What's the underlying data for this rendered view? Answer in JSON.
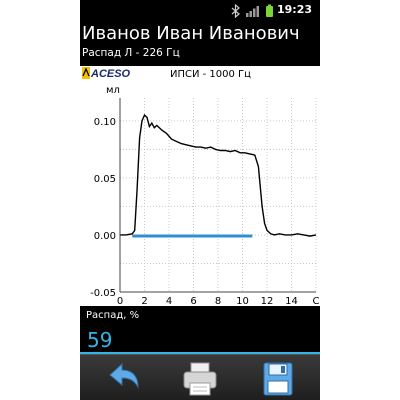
{
  "status_bar": {
    "time": "19:23",
    "icons": [
      "bluetooth-icon",
      "signal-icon",
      "battery-icon"
    ]
  },
  "header": {
    "patient_name": "Иванов Иван Иванович",
    "test_name": "Распад Л - 226 Гц"
  },
  "chart": {
    "logo_text": "ACESO",
    "probe_label": "ИПСИ - 1000 Гц",
    "y_unit": "мл",
    "colors": {
      "curve": "#000000",
      "baseline": "#2f8fd4",
      "grid": "#c8c8c8"
    }
  },
  "chart_data": {
    "type": "line",
    "title": "ИПСИ - 1000 Гц",
    "ylabel": "мл",
    "xlabel": "",
    "ylim": [
      -0.05,
      0.12
    ],
    "xlim": [
      0,
      16
    ],
    "y_ticks": [
      "0.10",
      "0.05",
      "0.00",
      "-0.05"
    ],
    "x_ticks": [
      "0",
      "2",
      "4",
      "6",
      "8",
      "10",
      "12",
      "14",
      "С"
    ],
    "grid": true,
    "series": [
      {
        "values_x": [
          0,
          0.5,
          1.0,
          1.2,
          1.4,
          1.6,
          1.8,
          2.0,
          2.2,
          2.4,
          2.6,
          2.8,
          3.0,
          3.4,
          3.8,
          4.2,
          4.6,
          5.0,
          5.4,
          5.8,
          6.2,
          6.6,
          7.0,
          7.4,
          7.8,
          8.2,
          8.6,
          9.0,
          9.4,
          9.8,
          10.2,
          10.6,
          11.0,
          11.3,
          11.6,
          11.8,
          12.0,
          12.3,
          12.6,
          13.0,
          13.5,
          14.0,
          14.5,
          15.0,
          15.5,
          16.0
        ],
        "values_y": [
          0.0,
          0.0,
          0.001,
          0.004,
          0.04,
          0.085,
          0.1,
          0.105,
          0.103,
          0.095,
          0.098,
          0.094,
          0.096,
          0.092,
          0.089,
          0.084,
          0.082,
          0.08,
          0.079,
          0.078,
          0.077,
          0.077,
          0.076,
          0.077,
          0.075,
          0.074,
          0.074,
          0.073,
          0.074,
          0.072,
          0.072,
          0.071,
          0.07,
          0.06,
          0.025,
          0.01,
          0.004,
          0.001,
          0.0,
          0.001,
          0.0,
          0.0,
          0.001,
          0.0,
          -0.001,
          0.0
        ]
      }
    ],
    "baseline_segment": {
      "x_start": 1.0,
      "x_end": 10.8,
      "y": 0.0
    }
  },
  "result": {
    "label": "Распад, %",
    "value": "59"
  },
  "toolbar": {
    "buttons": [
      "back-arrow-icon",
      "printer-icon",
      "save-disk-icon"
    ]
  }
}
